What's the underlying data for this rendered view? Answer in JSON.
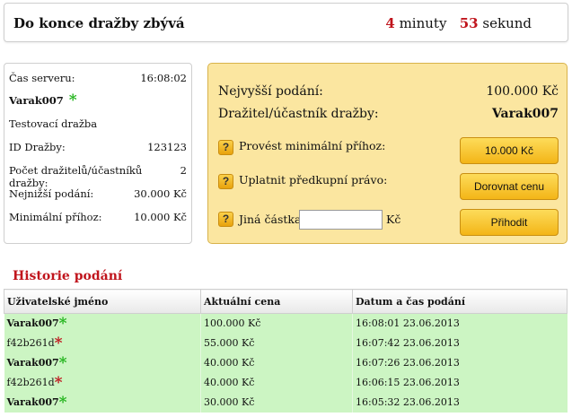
{
  "timer": {
    "title": "Do konce dražby zbývá",
    "minutes_value": "4",
    "minutes_label": "minuty",
    "seconds_value": "53",
    "seconds_label": "sekund"
  },
  "info": {
    "server_time_label": "Čas serveru:",
    "server_time_value": "16:08:02",
    "username": "Varak007",
    "auction_name": "Testovací dražba",
    "auction_id_label": "ID Dražby:",
    "auction_id_value": "123123",
    "bidder_count_label": "Počet dražitelů/účastníků dražby:",
    "bidder_count_value": "2",
    "min_bid_label": "Nejnižší podání:",
    "min_bid_value": "30.000 Kč",
    "min_increment_label": "Minimální příhoz:",
    "min_increment_value": "10.000 Kč"
  },
  "bid": {
    "highest_label": "Nejvyšší podání:",
    "highest_value": "100.000 Kč",
    "holder_label": "Dražitel/účastník dražby:",
    "holder_value": "Varak007",
    "help_symbol": "?",
    "option1_label": "Provést minimální příhoz:",
    "option1_button": "10.000 Kč",
    "option2_label": "Uplatnit předkupní právo:",
    "option2_button": "Dorovnat cenu",
    "option3_label": "Jiná částka:",
    "option3_input_value": "",
    "option3_suffix": "Kč",
    "option3_button": "Přihodit"
  },
  "history": {
    "title": "Historie podání",
    "columns": [
      "Uživatelské jméno",
      "Aktuální cena",
      "Datum a čas podání"
    ],
    "rows": [
      {
        "user": "Varak007",
        "price": "100.000 Kč",
        "datetime": "16:08:01 23.06.2013"
      },
      {
        "user": "f42b261d",
        "price": "55.000 Kč",
        "datetime": "16:07:42 23.06.2013"
      },
      {
        "user": "Varak007",
        "price": "40.000 Kč",
        "datetime": "16:07:26 23.06.2013"
      },
      {
        "user": "f42b261d",
        "price": "40.000 Kč",
        "datetime": "16:06:15 23.06.2013"
      },
      {
        "user": "Varak007",
        "price": "30.000 Kč",
        "datetime": "16:05:32 23.06.2013"
      }
    ]
  },
  "colors": {
    "accent_red": "#c0141c",
    "star_green": "#22b41c",
    "panel_yellow": "#fbe6a0",
    "row_green": "#ccf5c3"
  }
}
